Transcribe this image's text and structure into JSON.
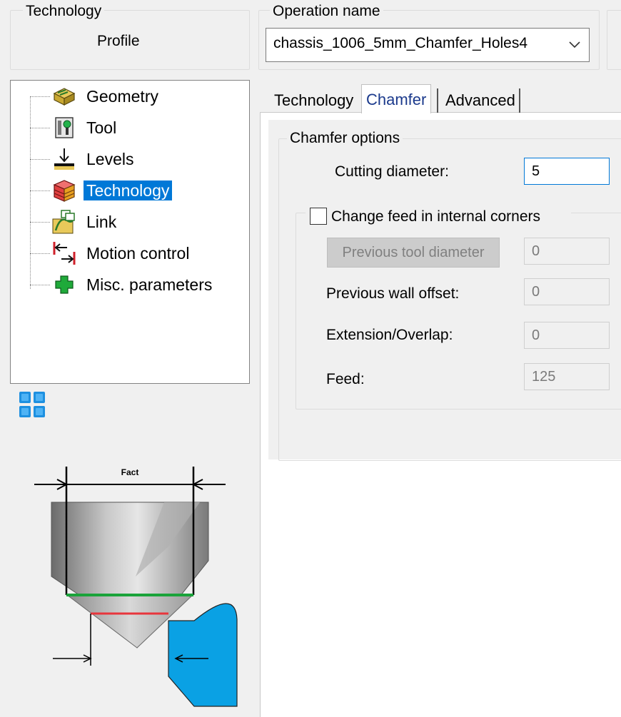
{
  "header": {
    "technology_group_label": "Technology",
    "technology_value": "Profile",
    "operation_group_label": "Operation name",
    "operation_name_value": "chassis_1006_5mm_Chamfer_Holes4"
  },
  "tree": {
    "items": [
      {
        "label": "Geometry",
        "icon": "geometry-icon"
      },
      {
        "label": "Tool",
        "icon": "tool-icon"
      },
      {
        "label": "Levels",
        "icon": "levels-icon"
      },
      {
        "label": "Technology",
        "icon": "technology-icon",
        "selected": true
      },
      {
        "label": "Link",
        "icon": "link-icon"
      },
      {
        "label": "Motion control",
        "icon": "motion-control-icon"
      },
      {
        "label": "Misc. parameters",
        "icon": "misc-parameters-icon"
      }
    ]
  },
  "tabs": [
    {
      "label": "Technology",
      "active": false
    },
    {
      "label": "Chamfer",
      "active": true
    },
    {
      "label": "Advanced",
      "active": false
    }
  ],
  "chamfer_options": {
    "group_label": "Chamfer options",
    "cutting_diameter_label": "Cutting diameter:",
    "cutting_diameter_value": "5",
    "change_feed_label": "Change feed in internal corners",
    "change_feed_checked": false,
    "previous_tool_diameter_button": "Previous tool diameter",
    "previous_tool_diameter_value": "0",
    "previous_wall_offset_label": "Previous wall offset:",
    "previous_wall_offset_value": "0",
    "extension_overlap_label": "Extension/Overlap:",
    "extension_overlap_value": "0",
    "feed_label": "Feed:",
    "feed_value": "125"
  },
  "diagram": {
    "dimension_label": "Fact"
  },
  "colors": {
    "selection": "#0078d7",
    "tab_active_text": "#1b3a8c",
    "diagram_green": "#1aa33a",
    "diagram_red": "#e8353c",
    "diagram_blue": "#0aa1e4"
  }
}
